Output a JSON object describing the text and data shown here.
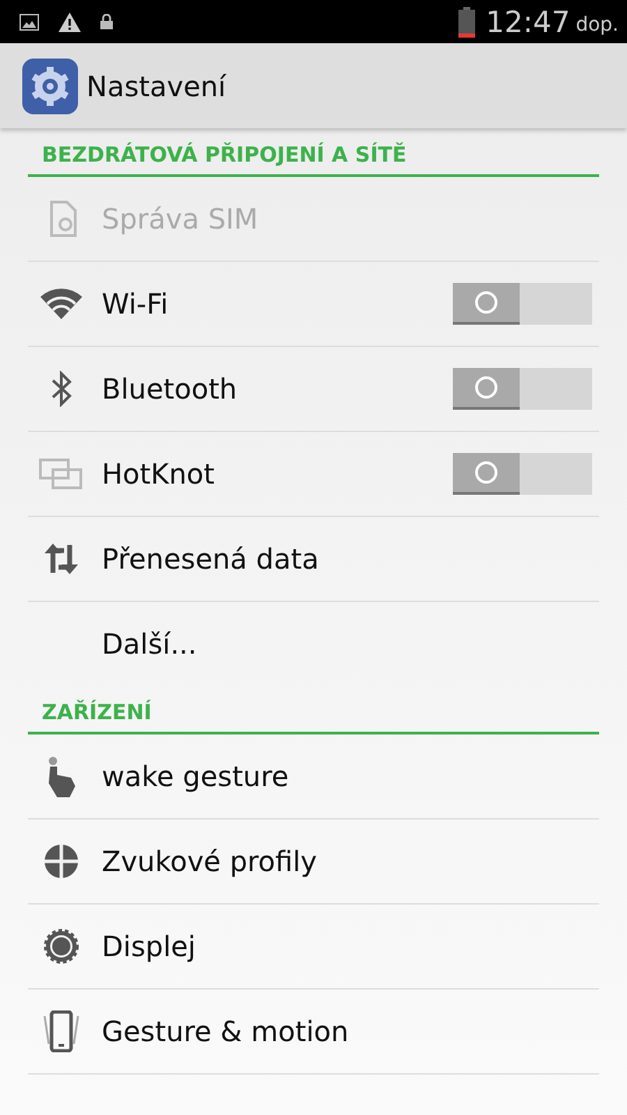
{
  "status_bar": {
    "time": "12:47",
    "ampm": "dop."
  },
  "app_bar": {
    "title": "Nastavení"
  },
  "sections": [
    {
      "title": "BEZDRÁTOVÁ PŘIPOJENÍ A SÍTĚ",
      "items": [
        {
          "kind": "plain",
          "label": "Správa SIM",
          "disabled": true
        },
        {
          "kind": "toggle",
          "label": "Wi-Fi",
          "disabled": false,
          "on": false
        },
        {
          "kind": "toggle",
          "label": "Bluetooth",
          "disabled": false,
          "on": false
        },
        {
          "kind": "toggle",
          "label": "HotKnot",
          "disabled": false,
          "on": false
        },
        {
          "kind": "plain",
          "label": "Přenesená data",
          "disabled": false
        },
        {
          "kind": "plain",
          "label": "Další...",
          "disabled": false
        }
      ]
    },
    {
      "title": "ZAŘÍZENÍ",
      "items": [
        {
          "kind": "plain",
          "label": "wake gesture",
          "disabled": false
        },
        {
          "kind": "plain",
          "label": "Zvukové profily",
          "disabled": false
        },
        {
          "kind": "plain",
          "label": "Displej",
          "disabled": false
        },
        {
          "kind": "plain",
          "label": "Gesture & motion",
          "disabled": false
        }
      ]
    }
  ]
}
